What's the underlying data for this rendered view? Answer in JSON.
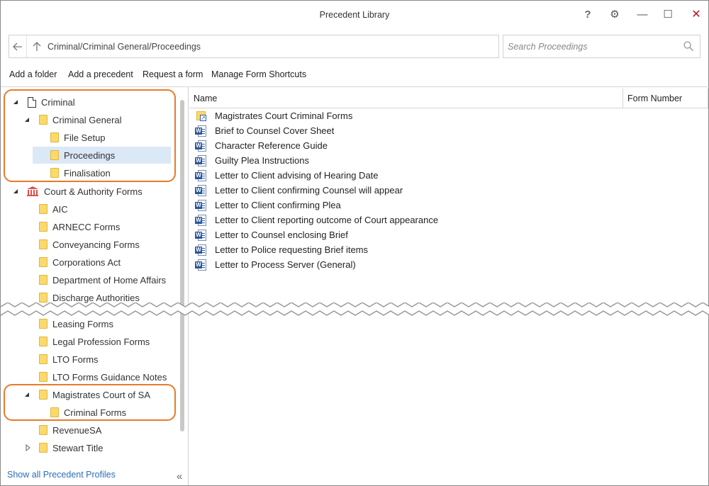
{
  "window": {
    "title": "Precedent Library",
    "help_glyph": "?",
    "gear_glyph": "⚙",
    "minimize_glyph": "—",
    "maximize_glyph": "☐",
    "close_glyph": "✕"
  },
  "nav": {
    "back_glyph": "←",
    "up_glyph": "↑",
    "path": "Criminal/Criminal General/Proceedings",
    "search_placeholder": "Search Proceedings"
  },
  "menu": {
    "add_folder": "Add a folder",
    "add_precedent": "Add a precedent",
    "request_form": "Request a form",
    "manage_shortcuts": "Manage Form Shortcuts"
  },
  "tree": {
    "criminal": "Criminal",
    "criminal_general": "Criminal General",
    "file_setup": "File Setup",
    "proceedings": "Proceedings",
    "finalisation": "Finalisation",
    "court_authority": "Court & Authority Forms",
    "aic": "AIC",
    "arnecc": "ARNECC Forms",
    "conveyancing": "Conveyancing Forms",
    "corporations": "Corporations Act",
    "home_affairs": "Department of Home Affairs",
    "discharge": "Discharge Authorities",
    "leasing": "Leasing Forms",
    "legal_profession": "Legal Profession Forms",
    "lto": "LTO Forms",
    "lto_guidance": "LTO Forms Guidance Notes",
    "magistrates": "Magistrates Court of SA",
    "criminal_forms": "Criminal Forms",
    "revenuesa": "RevenueSA",
    "stewart_title": "Stewart Title"
  },
  "footer": {
    "show_all": "Show all Precedent Profiles",
    "collapse_glyph": "«"
  },
  "list": {
    "col_name": "Name",
    "col_form_number": "Form Number",
    "items": [
      "Magistrates Court Criminal Forms",
      "Brief to Counsel Cover Sheet",
      "Character Reference Guide",
      "Guilty Plea Instructions",
      "Letter to Client advising of Hearing Date",
      "Letter to Client confirming Counsel will appear",
      "Letter to Client confirming Plea",
      "Letter to Client reporting outcome of Court appearance",
      "Letter to Counsel enclosing Brief",
      "Letter to Police requesting Brief items",
      "Letter to Process Server (General)"
    ]
  },
  "colors": {
    "highlight_outline": "#e87a2a",
    "selection": "#dbe8f6",
    "link": "#2a6ebb",
    "close": "#c0121c",
    "folder": "#fbd96a",
    "word_blue": "#2b579a"
  }
}
